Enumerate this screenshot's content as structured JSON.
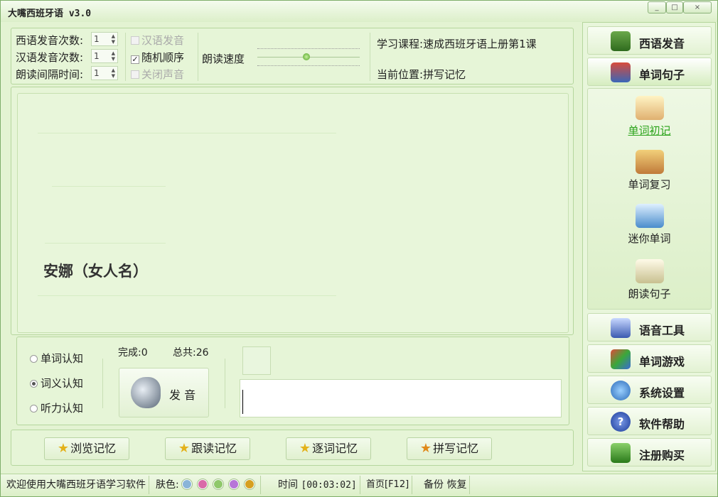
{
  "window": {
    "title": "大嘴西班牙语 v3.0",
    "min": "_",
    "max": "□",
    "close": "×"
  },
  "settings": {
    "spanish_count_label": "西语发音次数:",
    "spanish_count": "1",
    "chinese_count_label": "汉语发音次数:",
    "chinese_count": "1",
    "interval_label": "朗读间隔时间:",
    "interval": "1",
    "chk_chinese_voice": "汉语发音",
    "chk_random": "随机顺序",
    "chk_mute": "关闭声音",
    "speed_label": "朗读速度",
    "course_label": "学习课程:",
    "course": "速成西班牙语上册第1课",
    "position_label": "当前位置:",
    "position": "拼写记忆"
  },
  "card": {
    "word": "安娜（女人名）"
  },
  "controls": {
    "modes": [
      "单词认知",
      "词义认知",
      "听力认知"
    ],
    "done_label": "完成:",
    "done": "0",
    "total_label": "总共:",
    "total": "26",
    "play_label": "发 音"
  },
  "memory_buttons": [
    "浏览记忆",
    "跟读记忆",
    "逐词记忆",
    "拼写记忆"
  ],
  "sidebar": {
    "top": [
      {
        "label": "西语发音",
        "icon": "book-s-icon"
      },
      {
        "label": "单词句子",
        "icon": "books-stack-icon"
      }
    ],
    "items": [
      {
        "label": "单词初记",
        "icon": "open-book-bulb-icon"
      },
      {
        "label": "单词复习",
        "icon": "book-pencil-icon"
      },
      {
        "label": "迷你单词",
        "icon": "monitor-icon"
      },
      {
        "label": "朗读句子",
        "icon": "open-book-pen-icon"
      }
    ],
    "bottom": [
      {
        "label": "语音工具",
        "icon": "cd-tool-icon"
      },
      {
        "label": "单词游戏",
        "icon": "cards-game-icon"
      },
      {
        "label": "系统设置",
        "icon": "gears-icon"
      },
      {
        "label": "软件帮助",
        "icon": "help-icon"
      },
      {
        "label": "注册购买",
        "icon": "register-icon"
      }
    ]
  },
  "status": {
    "welcome": "欢迎使用大嘴西班牙语学习软件",
    "skin_label": "肤色:",
    "skin_colors": [
      "#8ab4d8",
      "#d96aa8",
      "#8fc86a",
      "#b776d8",
      "#d6a020"
    ],
    "time_label": "时间",
    "time": "[00:03:02]",
    "home": "首页[F12]",
    "backup": "备份",
    "restore": "恢复"
  }
}
